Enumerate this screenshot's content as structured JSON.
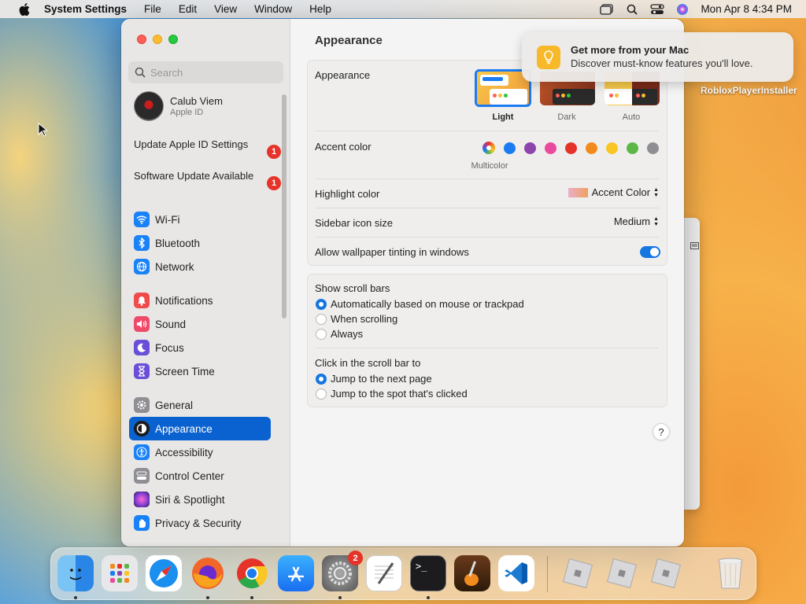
{
  "menubar": {
    "app_name": "System Settings",
    "menus": [
      "File",
      "Edit",
      "View",
      "Window",
      "Help"
    ],
    "clock": "Mon Apr 8  4:34 PM"
  },
  "sidebar": {
    "search_placeholder": "Search",
    "account": {
      "name": "Calub Viem",
      "subtitle": "Apple ID"
    },
    "notices": [
      {
        "label": "Update Apple ID Settings",
        "badge": "1"
      },
      {
        "label": "Software Update Available",
        "badge": "1"
      }
    ],
    "items": [
      {
        "label": "Wi-Fi",
        "icon": "wifi-icon",
        "color": "#1a82f7"
      },
      {
        "label": "Bluetooth",
        "icon": "bluetooth-icon",
        "color": "#1a82f7"
      },
      {
        "label": "Network",
        "icon": "globe-icon",
        "color": "#1a82f7"
      },
      {
        "label": "Notifications",
        "icon": "bell-icon",
        "color": "#f04a4a"
      },
      {
        "label": "Sound",
        "icon": "speaker-icon",
        "color": "#f04a6a"
      },
      {
        "label": "Focus",
        "icon": "moon-icon",
        "color": "#6b4fd8"
      },
      {
        "label": "Screen Time",
        "icon": "hourglass-icon",
        "color": "#6b4fd8"
      },
      {
        "label": "General",
        "icon": "gear-icon",
        "color": "#8e8e93"
      },
      {
        "label": "Appearance",
        "icon": "appearance-icon",
        "color": "#1c1c1e",
        "selected": true
      },
      {
        "label": "Accessibility",
        "icon": "accessibility-icon",
        "color": "#1a82f7"
      },
      {
        "label": "Control Center",
        "icon": "control-center-icon",
        "color": "#8e8e93"
      },
      {
        "label": "Siri & Spotlight",
        "icon": "siri-icon",
        "color": "#b03ad0"
      },
      {
        "label": "Privacy & Security",
        "icon": "hand-icon",
        "color": "#1a82f7"
      }
    ]
  },
  "main": {
    "title": "Appearance",
    "appearance": {
      "label": "Appearance",
      "options": [
        "Light",
        "Dark",
        "Auto"
      ],
      "selected": "Light"
    },
    "accent": {
      "label": "Accent color",
      "multicolor_caption": "Multicolor",
      "colors": [
        "#1a7bf2",
        "#8e44ad",
        "#ea4a9d",
        "#e5332a",
        "#f28b1d",
        "#f9c623",
        "#5cb746",
        "#8e8e93"
      ]
    },
    "highlight": {
      "label": "Highlight color",
      "value": "Accent Color"
    },
    "sidebar_icon_size": {
      "label": "Sidebar icon size",
      "value": "Medium"
    },
    "wallpaper_tinting": {
      "label": "Allow wallpaper tinting in windows",
      "enabled": true
    },
    "scroll_bars": {
      "label": "Show scroll bars",
      "options": [
        "Automatically based on mouse or trackpad",
        "When scrolling",
        "Always"
      ],
      "selected": 0
    },
    "click_scroll": {
      "label": "Click in the scroll bar to",
      "options": [
        "Jump to the next page",
        "Jump to the spot that's clicked"
      ],
      "selected": 0
    },
    "help": "?"
  },
  "notification": {
    "title": "Get more from your Mac",
    "body": "Discover must-know features you'll love."
  },
  "desktop": {
    "file_label": "RobloxPlayerInstaller"
  },
  "dock": {
    "apps": [
      "Finder",
      "Launchpad",
      "Safari",
      "Firefox",
      "Chrome",
      "App Store",
      "System Settings",
      "TextEdit",
      "Terminal",
      "GarageBand",
      "Visual Studio Code",
      "Roblox",
      "Roblox",
      "Roblox",
      "Trash"
    ],
    "settings_badge": "2"
  }
}
